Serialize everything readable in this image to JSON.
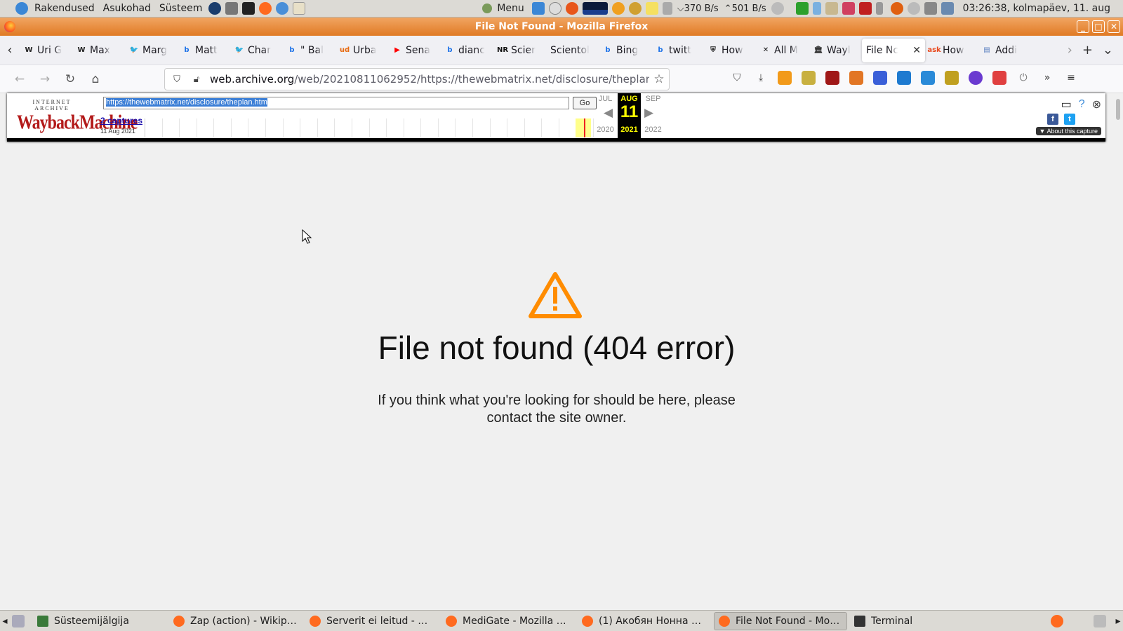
{
  "top_panel": {
    "menu_items": [
      "Rakendused",
      "Asukohad",
      "Süsteem"
    ],
    "applet_menu": "Menu",
    "net_down": "370 B/s",
    "net_up": "501 B/s",
    "clock": "03:26:38, kolmapäev, 11. aug"
  },
  "window": {
    "title": "File Not Found - Mozilla Firefox"
  },
  "tabs": [
    {
      "label": "Uri G",
      "icon": "wikipedia-icon",
      "fav": "W",
      "color": "#222222"
    },
    {
      "label": "Max",
      "icon": "wikipedia-icon",
      "fav": "W",
      "color": "#222222"
    },
    {
      "label": "Marg",
      "icon": "twitter-icon",
      "fav": "🐦",
      "color": "#1da1f2"
    },
    {
      "label": "Matt",
      "icon": "bing-icon",
      "fav": "b",
      "color": "#1e73e8"
    },
    {
      "label": "Char",
      "icon": "twitter-icon",
      "fav": "🐦",
      "color": "#1da1f2"
    },
    {
      "label": "\" Bal",
      "icon": "bing-icon",
      "fav": "b",
      "color": "#1e73e8"
    },
    {
      "label": "Urba",
      "icon": "urban-dictionary-icon",
      "fav": "ud",
      "color": "#e86a10"
    },
    {
      "label": "Sena",
      "icon": "youtube-icon",
      "fav": "▶",
      "color": "#ff0000"
    },
    {
      "label": "dianc",
      "icon": "bing-icon",
      "fav": "b",
      "color": "#1e73e8"
    },
    {
      "label": "Scier",
      "icon": "nr-icon",
      "fav": "NR",
      "color": "#111111"
    },
    {
      "label": "Scientol",
      "icon": "",
      "fav": "",
      "color": ""
    },
    {
      "label": "Bing",
      "icon": "bing-icon",
      "fav": "b",
      "color": "#1e73e8"
    },
    {
      "label": "twitt",
      "icon": "bing-icon",
      "fav": "b",
      "color": "#1e73e8"
    },
    {
      "label": "How",
      "icon": "shield-icon",
      "fav": "⛨",
      "color": "#222222"
    },
    {
      "label": "All M",
      "icon": "x-icon",
      "fav": "✕",
      "color": "#111111"
    },
    {
      "label": "Wayl",
      "icon": "archive-icon",
      "fav": "🏛",
      "color": "#333333"
    },
    {
      "label": "File Nc",
      "icon": "",
      "fav": "",
      "color": "",
      "active": true
    },
    {
      "label": "How",
      "icon": "ask-icon",
      "fav": "ask",
      "color": "#e8491e"
    },
    {
      "label": "Addi",
      "icon": "page-icon",
      "fav": "▤",
      "color": "#5a7fc0"
    }
  ],
  "nav": {
    "url_host": "web.archive.org",
    "url_rest": "/web/20210811062952/https://thewebmatrix.net/disclosure/theplan.htm"
  },
  "wayback": {
    "logo_top": "INTERNET ARCHIVE",
    "logo_main": "WaybackMachine",
    "url_value": "https://thewebmatrix.net/disclosure/theplan.htm",
    "go": "Go",
    "captures": "2 captures",
    "capture_date": "11 Aug 2021",
    "prev_month": "JUL",
    "cur_month": "AUG",
    "next_month": "SEP",
    "cur_day": "11",
    "prev_year": "2020",
    "cur_year": "2021",
    "next_year": "2022",
    "about": "▼ About this capture"
  },
  "error": {
    "title": "File not found (404 error)",
    "description": "If you think what you're looking for should be here, please contact the site owner.",
    "accent_color": "#ff8c00"
  },
  "taskbar": {
    "tasks": [
      {
        "label": "Süsteemijälgija",
        "icon": "monitor-icon",
        "color": "#3a7a3a"
      },
      {
        "label": "Zap (action) - Wikiped...",
        "icon": "firefox-icon",
        "color": "#ff6a1f"
      },
      {
        "label": "Serverit ei leitud - Mo...",
        "icon": "firefox-icon",
        "color": "#ff6a1f"
      },
      {
        "label": "MediGate - Mozilla Fir...",
        "icon": "firefox-icon",
        "color": "#ff6a1f"
      },
      {
        "label": "(1) Акобян Нонна Юр...",
        "icon": "firefox-icon",
        "color": "#ff6a1f"
      },
      {
        "label": "File Not Found - Mozill...",
        "icon": "firefox-icon",
        "color": "#ff6a1f",
        "active": true
      },
      {
        "label": "Terminal",
        "icon": "terminal-icon",
        "color": "#333333"
      }
    ]
  }
}
